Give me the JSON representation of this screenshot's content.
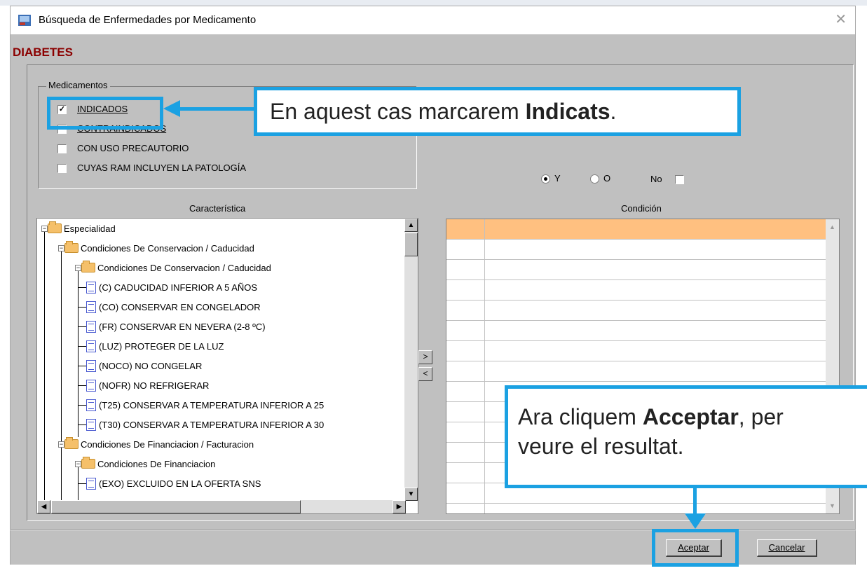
{
  "window": {
    "title": "Búsqueda de Enfermedades por Medicamento",
    "close": "✕"
  },
  "heading": "DIABETES",
  "medicamentos": {
    "legend": "Medicamentos",
    "options": [
      {
        "label": "INDICADOS",
        "checked": true
      },
      {
        "label": "CONTRAINDICADOS",
        "checked": false
      },
      {
        "label": "CON USO PRECAUTORIO",
        "checked": false
      },
      {
        "label": "CUYAS RAM INCLUYEN LA PATOLOGÍA",
        "checked": false
      }
    ]
  },
  "logic": {
    "y_label": "Y",
    "o_label": "O",
    "no_label": "No",
    "selected": "Y"
  },
  "columns": {
    "caracteristica": "Característica",
    "condicion": "Condición"
  },
  "tree": [
    {
      "label": "Especialidad",
      "type": "folder",
      "level": 0
    },
    {
      "label": "Condiciones De Conservacion / Caducidad",
      "type": "folder",
      "level": 1
    },
    {
      "label": "Condiciones De Conservacion / Caducidad",
      "type": "folder",
      "level": 2
    },
    {
      "label": "(C) CADUCIDAD INFERIOR A 5 AÑOS",
      "type": "doc",
      "level": 3
    },
    {
      "label": "(CO) CONSERVAR EN CONGELADOR",
      "type": "doc",
      "level": 3
    },
    {
      "label": "(FR) CONSERVAR EN NEVERA (2-8 ºC)",
      "type": "doc",
      "level": 3
    },
    {
      "label": "(LUZ) PROTEGER DE LA LUZ",
      "type": "doc",
      "level": 3
    },
    {
      "label": "(NOCO) NO CONGELAR",
      "type": "doc",
      "level": 3
    },
    {
      "label": "(NOFR) NO REFRIGERAR",
      "type": "doc",
      "level": 3
    },
    {
      "label": "(T25) CONSERVAR A TEMPERATURA INFERIOR A 25",
      "type": "doc",
      "level": 3
    },
    {
      "label": "(T30) CONSERVAR A TEMPERATURA INFERIOR A 30",
      "type": "doc",
      "level": 3
    },
    {
      "label": "Condiciones De Financiacion / Facturacion",
      "type": "folder",
      "level": 1
    },
    {
      "label": "Condiciones De Financiacion",
      "type": "folder",
      "level": 2
    },
    {
      "label": "(EXO) EXCLUIDO EN LA OFERTA SNS",
      "type": "doc",
      "level": 3
    }
  ],
  "transfer": {
    "add": ">",
    "remove": "<"
  },
  "buttons": {
    "accept": "Aceptar",
    "cancel": "Cancelar"
  },
  "callouts": {
    "top": {
      "before": "En aquest cas marcarem ",
      "bold": "Indicats",
      "after": "."
    },
    "bottom": {
      "line1_before": "Ara cliquem ",
      "line1_bold": "Acceptar",
      "line1_after": ", per",
      "line2": "veure el resultat."
    }
  },
  "colors": {
    "accent": "#1ba1e2",
    "heading": "#8b0000",
    "grid_header": "#ffc080"
  }
}
